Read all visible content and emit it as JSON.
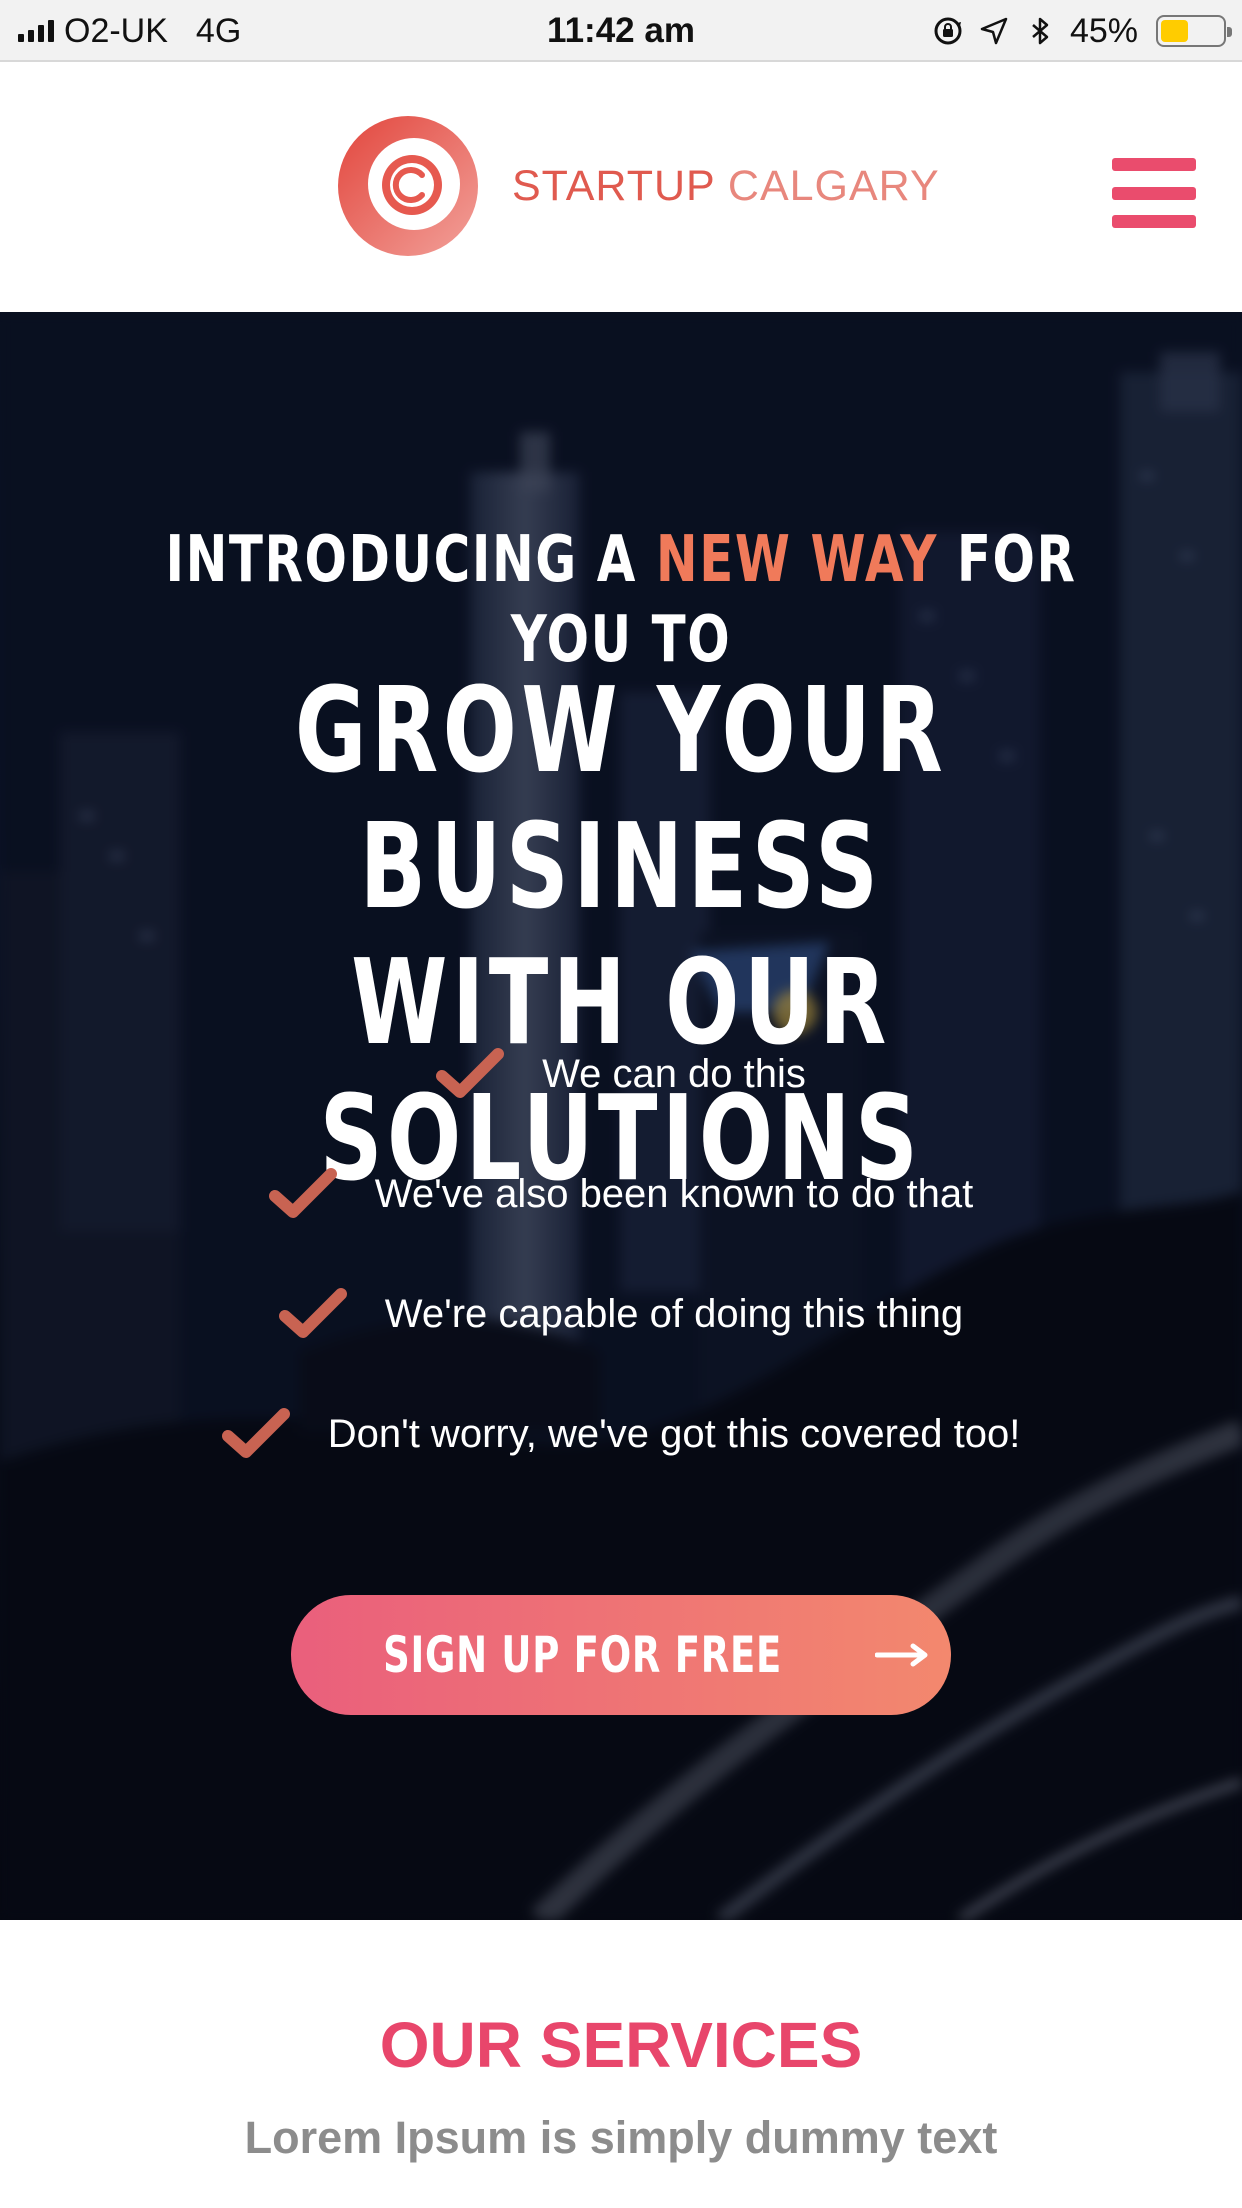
{
  "status_bar": {
    "carrier": "O2-UK",
    "network": "4G",
    "time": "11:42 am",
    "battery_percent_label": "45%",
    "battery_level": 0.45,
    "icons": [
      "signal-bars-icon",
      "rotation-lock-icon",
      "location-arrow-icon",
      "bluetooth-icon",
      "battery-icon"
    ]
  },
  "header": {
    "logo_word1": "STARTUP",
    "logo_word2": "CALGARY",
    "menu_icon": "hamburger-menu-icon",
    "colors": {
      "logo": "#e05a4f",
      "menu": "#ea4c6d"
    }
  },
  "hero": {
    "intro_before": "INTRODUCING A",
    "intro_accent": "NEW WAY",
    "intro_after": "FOR YOU TO",
    "headline_line1": "GROW YOUR BUSINESS",
    "headline_line2": "WITH OUR SOLUTIONS",
    "features": [
      "We can do this",
      "We've also been known to do that",
      "We're capable of doing this thing",
      "Don't worry, we've got this covered too!"
    ],
    "check_icon": "check-icon",
    "cta_label": "SIGN UP FOR FREE",
    "cta_icon": "arrow-right-icon",
    "colors": {
      "accent": "#f07a5a",
      "check": "#c86352",
      "cta_start": "#ea5f7c",
      "cta_end": "#f3886e"
    }
  },
  "services": {
    "title": "OUR SERVICES",
    "subtitle": "Lorem Ipsum is simply dummy text",
    "colors": {
      "title": "#e8466b",
      "subtitle": "#8c8c8c"
    }
  }
}
